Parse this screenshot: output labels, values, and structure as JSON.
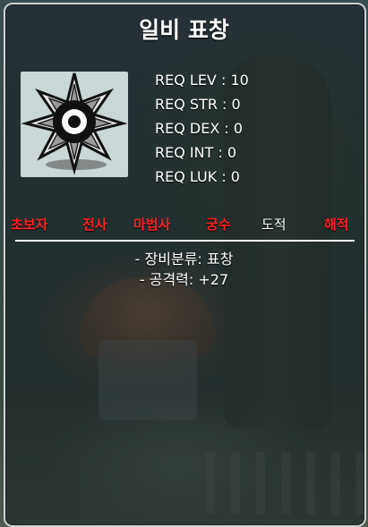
{
  "item": {
    "name": "일비 표창",
    "icon": "throwing-star-icon"
  },
  "requirements": [
    {
      "label": "REQ LEV : 10"
    },
    {
      "label": "REQ STR : 0"
    },
    {
      "label": "REQ DEX : 0"
    },
    {
      "label": "REQ INT : 0"
    },
    {
      "label": "REQ LUK : 0"
    }
  ],
  "jobs": [
    {
      "label": "초보자",
      "available": false
    },
    {
      "label": "전사",
      "available": false
    },
    {
      "label": "마법사",
      "available": false
    },
    {
      "label": "궁수",
      "available": false
    },
    {
      "label": "도적",
      "available": true
    },
    {
      "label": "해적",
      "available": false
    }
  ],
  "colors": {
    "available": "#ffffff",
    "unavailable": "#ff2020"
  },
  "stats": [
    {
      "label": "- 장비분류: 표창"
    },
    {
      "label": "- 공격력: +27"
    }
  ]
}
